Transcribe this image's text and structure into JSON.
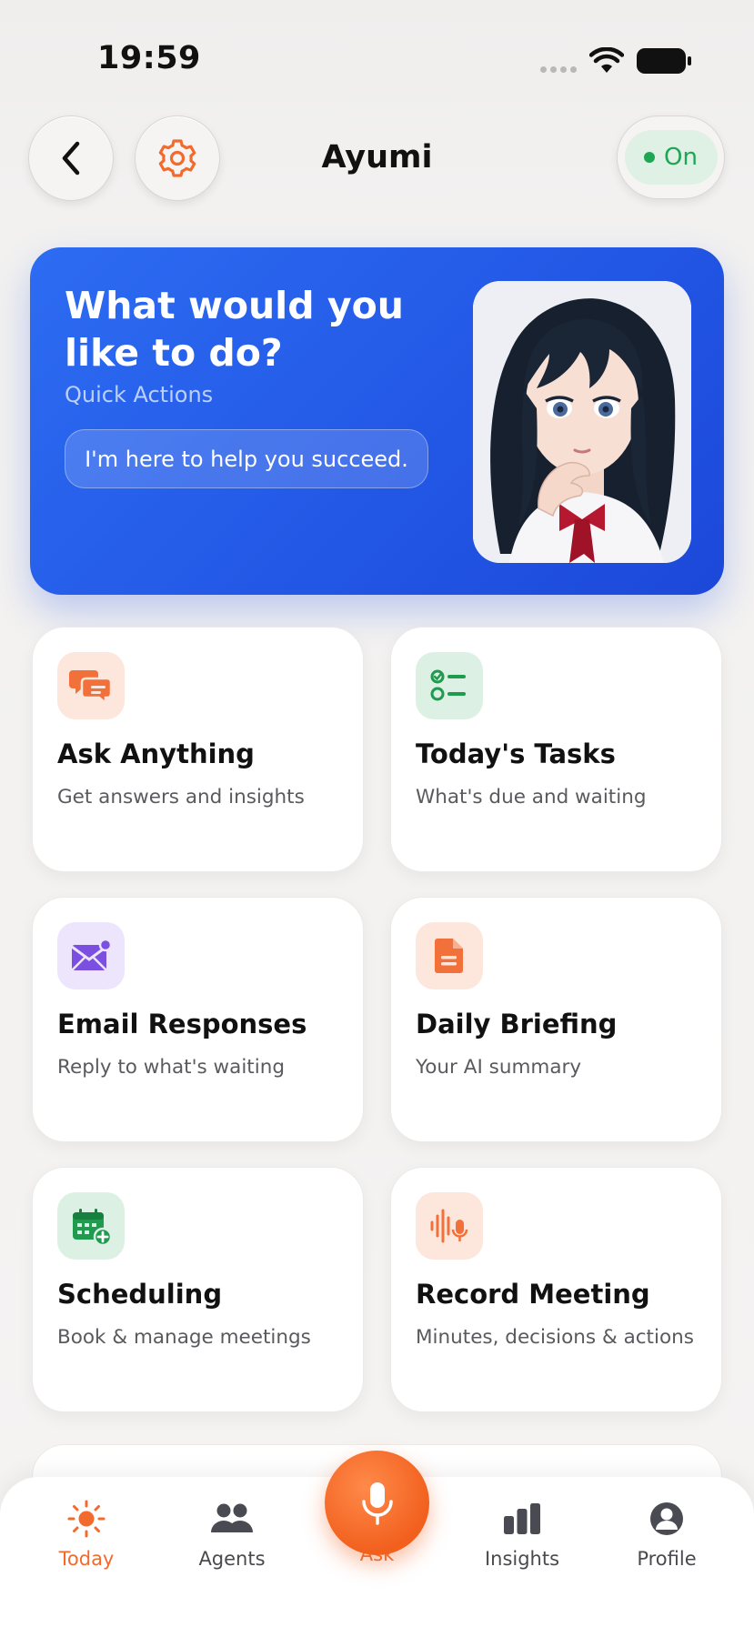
{
  "status_bar": {
    "time": "19:59"
  },
  "header": {
    "title": "Ayumi",
    "toggle_label": "On"
  },
  "hero": {
    "title": "What would you like to do?",
    "subtitle": "Quick Actions",
    "chip": "I'm here to help you succeed."
  },
  "cards": [
    {
      "title": "Ask Anything",
      "desc": "Get answers and insights",
      "icon": "chat-bubbles-icon",
      "color": "#f2703a"
    },
    {
      "title": "Today's Tasks",
      "desc": "What's due and waiting",
      "icon": "checklist-icon",
      "color": "#1f9a4f"
    },
    {
      "title": "Email Responses",
      "desc": "Reply to what's waiting",
      "icon": "envelope-icon",
      "color": "#7b4fe0"
    },
    {
      "title": "Daily Briefing",
      "desc": "Your AI summary",
      "icon": "document-icon",
      "color": "#f2703a"
    },
    {
      "title": "Scheduling",
      "desc": "Book & manage meetings",
      "icon": "calendar-add-icon",
      "color": "#1f9a4f"
    },
    {
      "title": "Record Meeting",
      "desc": "Minutes, decisions & actions",
      "icon": "waveform-mic-icon",
      "color": "#f2703a"
    }
  ],
  "tabs": {
    "today": "Today",
    "agents": "Agents",
    "ask": "Ask",
    "insights": "Insights",
    "profile": "Profile"
  },
  "colors": {
    "accent": "#f26b2c",
    "hero_blue": "#2358e6",
    "online_green": "#1fa655"
  }
}
